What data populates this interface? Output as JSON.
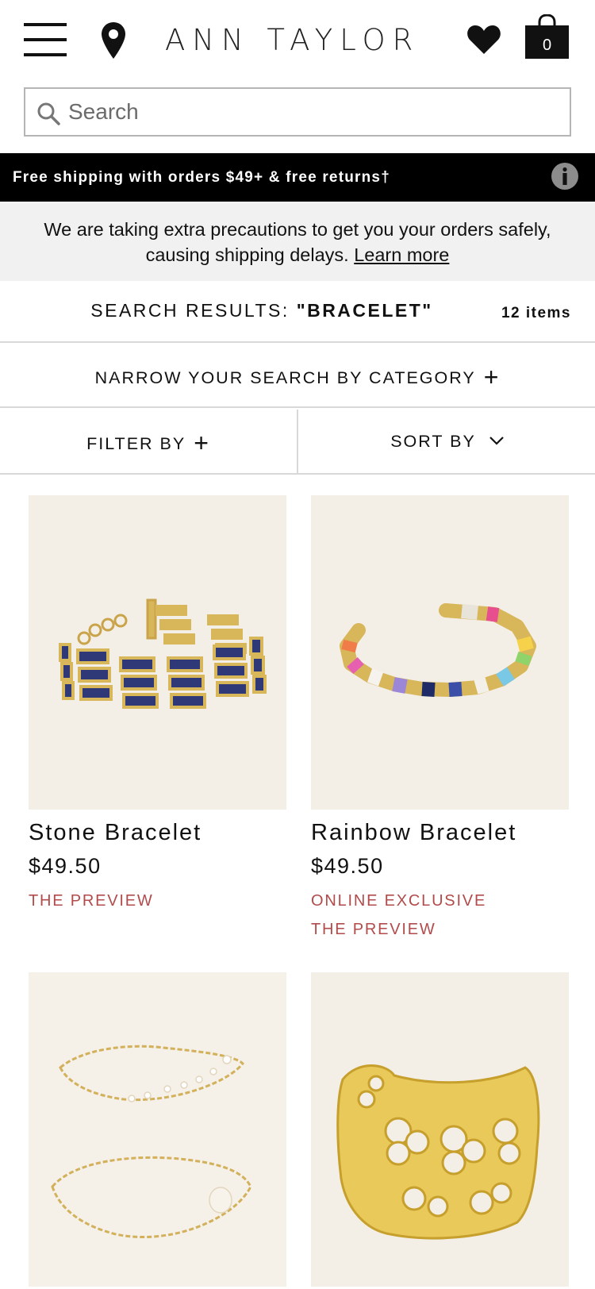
{
  "header": {
    "brand": "ANN TAYLOR",
    "bag_count": "0"
  },
  "search": {
    "placeholder": "Search"
  },
  "promo": {
    "text": "Free shipping with orders $49+ & free returns†"
  },
  "notice": {
    "text_line1": "We are taking extra precautions to get you your orders safely,",
    "text_line2": "causing shipping delays.",
    "link": "Learn more"
  },
  "results": {
    "label": "SEARCH RESULTS:",
    "query": "\"BRACELET\"",
    "count": "12 items"
  },
  "narrow": {
    "label": "NARROW YOUR SEARCH BY CATEGORY"
  },
  "filter": {
    "label": "FILTER BY"
  },
  "sort": {
    "label": "SORT BY"
  },
  "products": [
    {
      "name": "Stone Bracelet",
      "price": "$49.50",
      "tags": [
        "THE PREVIEW"
      ]
    },
    {
      "name": "Rainbow Bracelet",
      "price": "$49.50",
      "tags": [
        "ONLINE EXCLUSIVE",
        "THE PREVIEW"
      ]
    },
    {
      "name": "",
      "price": "",
      "tags": []
    },
    {
      "name": "",
      "price": "",
      "tags": []
    }
  ],
  "colors": {
    "promo_bg": "#000000",
    "notice_bg": "#f1f1f1",
    "tag_red": "#b24b4b",
    "product_bg": "#f4efe6"
  }
}
